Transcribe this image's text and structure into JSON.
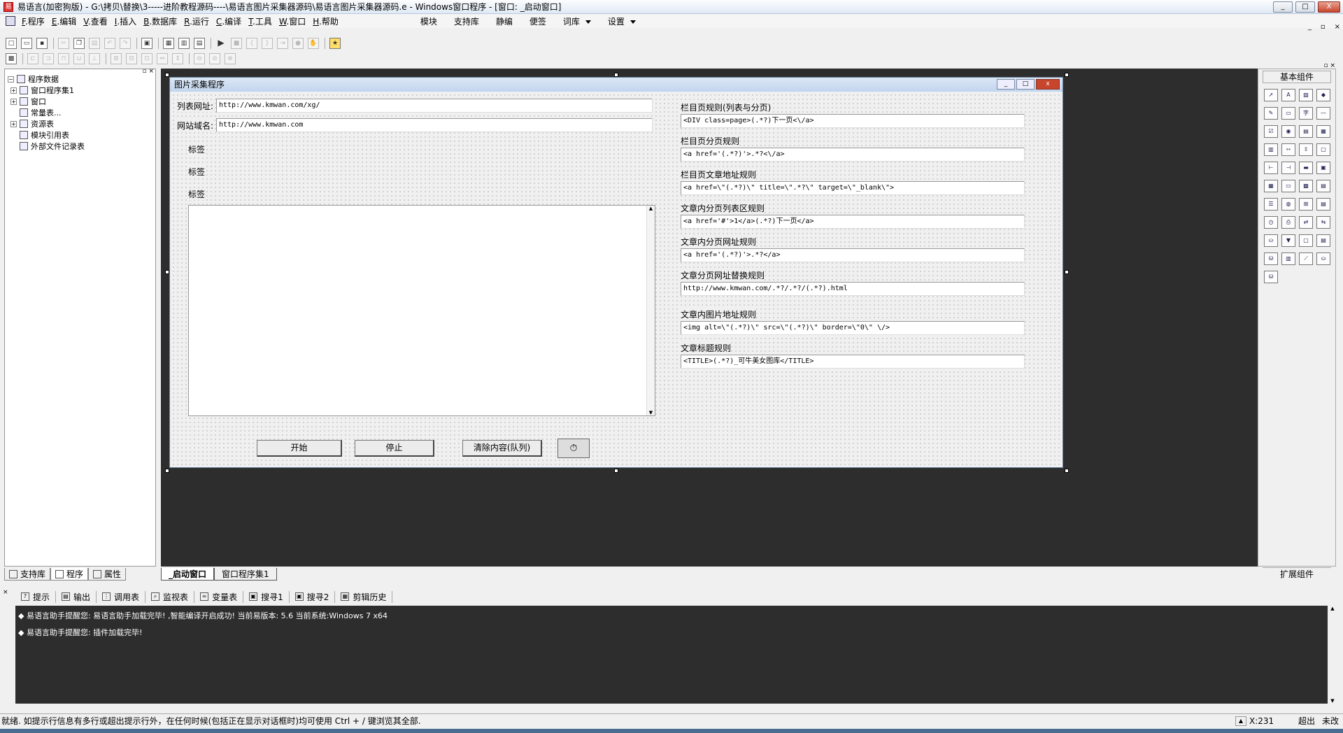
{
  "window": {
    "title": "易语言(加密狗版) - G:\\拷贝\\替换\\3-----进阶教程源码----\\易语言图片采集器源码\\易语言图片采集器源码.e - Windows窗口程序 - [窗口: _启动窗口]",
    "minimize": "_",
    "maximize": "□",
    "close": "X"
  },
  "menubar": {
    "items": [
      {
        "key": "F",
        "label": ".程序"
      },
      {
        "key": "E",
        "label": ".编辑"
      },
      {
        "key": "V",
        "label": ".查看"
      },
      {
        "key": "I",
        "label": ".插入"
      },
      {
        "key": "B",
        "label": ".数据库"
      },
      {
        "key": "R",
        "label": ".运行"
      },
      {
        "key": "C",
        "label": ".编译"
      },
      {
        "key": "T",
        "label": ".工具"
      },
      {
        "key": "W",
        "label": ".窗口"
      },
      {
        "key": "H",
        "label": ".帮助"
      }
    ],
    "extra": [
      "模块",
      "支持库",
      "静编",
      "便签",
      "词库",
      "设置"
    ]
  },
  "leftpanel": {
    "tree": [
      {
        "label": "程序数据",
        "indent": 0,
        "pm": "-"
      },
      {
        "label": "窗口程序集1",
        "indent": 1,
        "pm": "+"
      },
      {
        "label": "窗口",
        "indent": 1,
        "pm": "+"
      },
      {
        "label": "常量表...",
        "indent": 1,
        "pm": ""
      },
      {
        "label": "资源表",
        "indent": 1,
        "pm": "+"
      },
      {
        "label": "模块引用表",
        "indent": 1,
        "pm": ""
      },
      {
        "label": "外部文件记录表",
        "indent": 1,
        "pm": ""
      }
    ],
    "tabs": [
      "支持库",
      "程序",
      "属性"
    ]
  },
  "doctabs": [
    "_启动窗口",
    "窗口程序集1"
  ],
  "form": {
    "title": "图片采集程序",
    "list_url_label": "列表网址:",
    "list_url_value": "http://www.kmwan.com/xg/",
    "domain_label": "网站域名:",
    "domain_value": "http://www.kmwan.com",
    "tag_labels": [
      "标签",
      "标签",
      "标签"
    ],
    "rules": [
      {
        "label": "栏目页规则(列表与分页)",
        "value": "<DIV class=page>(.*?)下一页<\\/a>"
      },
      {
        "label": "栏目页分页规则",
        "value": "<a href='(.*?)'>.*?<\\/a>"
      },
      {
        "label": "栏目页文章地址规则",
        "value": "<a href=\\\"(.*?)\\\" title=\\\".*?\\\" target=\\\"_blank\\\">"
      },
      {
        "label": "文章内分页列表区规则",
        "value": "<a href='#'>1</a>(.*?)下一页</a>"
      },
      {
        "label": "文章内分页网址规则",
        "value": "<a href='(.*?)'>.*?</a>"
      },
      {
        "label": "文章分页网址替换规则",
        "value": "http://www.kmwan.com/.*?/.*?/(.*?).html"
      },
      {
        "label": "文章内图片地址规则",
        "value": "<img alt=\\\"(.*?)\\\" src=\\\"(.*?)\\\" border=\\\"0\\\" \\/>"
      },
      {
        "label": "文章标题规则",
        "value": "<TITLE>(.*?)_可牛美女图库</TITLE>"
      }
    ],
    "buttons": {
      "start": "开始",
      "stop": "停止",
      "clear": "清除内容(队列)"
    }
  },
  "palette": {
    "header": "基本组件",
    "footer": "扩展组件",
    "icons": [
      "pointer-icon",
      "label-icon",
      "image-icon",
      "shape-icon",
      "edit-icon",
      "box-icon",
      "font-icon",
      "line-icon",
      "checkbox-icon",
      "radio-icon",
      "list-icon",
      "grid-icon",
      "table-icon",
      "hscroll-icon",
      "vscroll-icon",
      "tab-icon",
      "ruler-icon",
      "split-icon",
      "progress-icon",
      "frame-icon",
      "calendar-icon",
      "text-icon",
      "folder-icon",
      "doc-icon",
      "menu-icon",
      "globe-icon",
      "tree-icon",
      "data-icon",
      "timer-icon",
      "print-icon",
      "link-icon",
      "link2-icon",
      "connect-icon",
      "filter-icon",
      "window-icon",
      "form-icon",
      "odbc-icon",
      "db-icon",
      "chart-icon",
      "odbc2-icon",
      "odbc3-icon"
    ]
  },
  "bottomtabs": [
    "提示",
    "输出",
    "调用表",
    "监视表",
    "变量表",
    "搜寻1",
    "搜寻2",
    "剪辑历史"
  ],
  "output": {
    "lines": [
      "◆ 易语言助手提醒您: 易语言助手加载完毕! ,智能编译开启成功! 当前易版本: 5.6 当前系统:Windows 7 x64",
      "◆ 易语言助手提醒您: 插件加载完毕!"
    ]
  },
  "status": {
    "text": "就绪. 如提示行信息有多行或超出提示行外，在任何时候(包括正在显示对话框时)均可使用 Ctrl + / 键浏览其全部.",
    "coord": "X:231",
    "mode1": "超出",
    "mode2": "未改"
  }
}
